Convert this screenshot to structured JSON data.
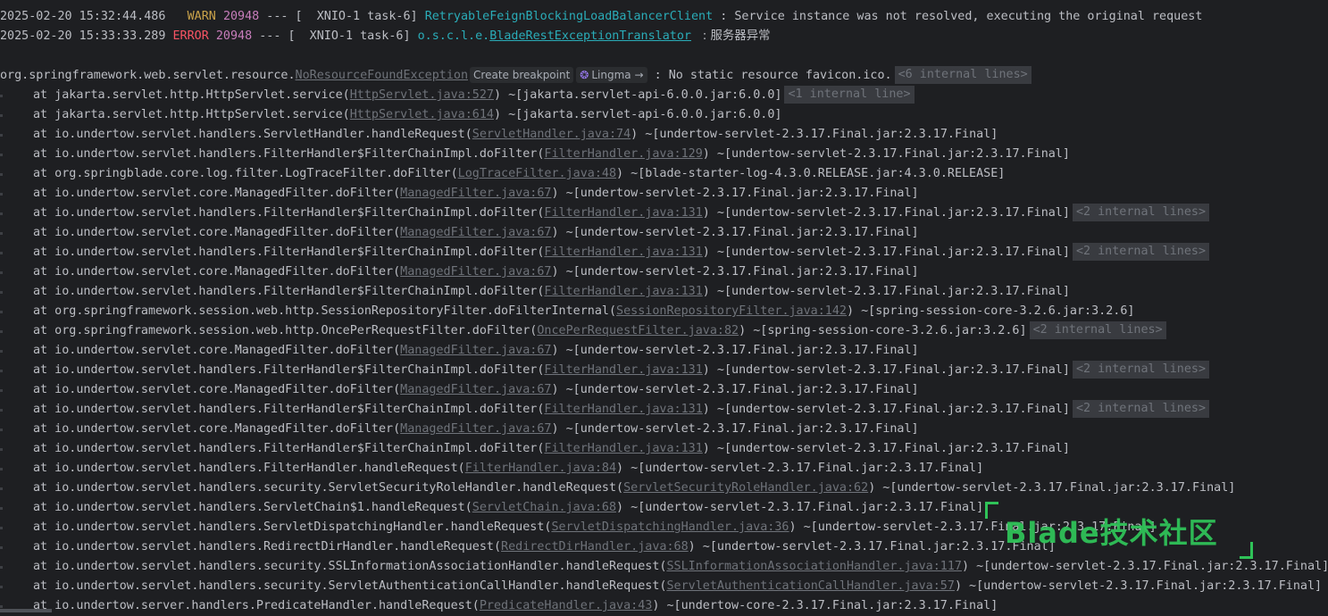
{
  "log_lines": [
    {
      "timestamp": "2025-02-20 15:32:44.486",
      "level": " WARN",
      "pid": "20948",
      "sep": " --- [",
      "thread": "  XNIO-1 task-6]",
      "logger": "RetryableFeignBlockingLoadBalancerClient",
      "message": " : Service instance was not resolved, executing the original request"
    },
    {
      "timestamp": "2025-02-20 15:33:33.289",
      "level": "ERROR",
      "pid": "20948",
      "sep": " --- [",
      "thread": "  XNIO-1 task-6]",
      "logger_prefix": "o.s.c.l.e.",
      "logger": "BladeRestExceptionTranslator",
      "message": "   : 服务器异常"
    }
  ],
  "exception": {
    "package": "org.springframework.web.servlet.resource.",
    "class": "NoResourceFoundException",
    "create_breakpoint": "Create breakpoint",
    "lingma": "Lingma →",
    "message": ": No static resource favicon.ico.",
    "fold": "<6 internal lines>"
  },
  "frames": [
    {
      "method": "at jakarta.servlet.http.HttpServlet.service(",
      "source": "HttpServlet.java:527",
      "jar": ") ~[jakarta.servlet-api-6.0.0.jar:6.0.0]",
      "fold": "<1 internal line>"
    },
    {
      "method": "at jakarta.servlet.http.HttpServlet.service(",
      "source": "HttpServlet.java:614",
      "jar": ") ~[jakarta.servlet-api-6.0.0.jar:6.0.0]",
      "fold": ""
    },
    {
      "method": "at io.undertow.servlet.handlers.ServletHandler.handleRequest(",
      "source": "ServletHandler.java:74",
      "jar": ") ~[undertow-servlet-2.3.17.Final.jar:2.3.17.Final]",
      "fold": ""
    },
    {
      "method": "at io.undertow.servlet.handlers.FilterHandler$FilterChainImpl.doFilter(",
      "source": "FilterHandler.java:129",
      "jar": ") ~[undertow-servlet-2.3.17.Final.jar:2.3.17.Final]",
      "fold": ""
    },
    {
      "method": "at org.springblade.core.log.filter.LogTraceFilter.doFilter(",
      "source": "LogTraceFilter.java:48",
      "jar": ") ~[blade-starter-log-4.3.0.RELEASE.jar:4.3.0.RELEASE]",
      "fold": ""
    },
    {
      "method": "at io.undertow.servlet.core.ManagedFilter.doFilter(",
      "source": "ManagedFilter.java:67",
      "jar": ") ~[undertow-servlet-2.3.17.Final.jar:2.3.17.Final]",
      "fold": ""
    },
    {
      "method": "at io.undertow.servlet.handlers.FilterHandler$FilterChainImpl.doFilter(",
      "source": "FilterHandler.java:131",
      "jar": ") ~[undertow-servlet-2.3.17.Final.jar:2.3.17.Final]",
      "fold": "<2 internal lines>"
    },
    {
      "method": "at io.undertow.servlet.core.ManagedFilter.doFilter(",
      "source": "ManagedFilter.java:67",
      "jar": ") ~[undertow-servlet-2.3.17.Final.jar:2.3.17.Final]",
      "fold": ""
    },
    {
      "method": "at io.undertow.servlet.handlers.FilterHandler$FilterChainImpl.doFilter(",
      "source": "FilterHandler.java:131",
      "jar": ") ~[undertow-servlet-2.3.17.Final.jar:2.3.17.Final]",
      "fold": "<2 internal lines>"
    },
    {
      "method": "at io.undertow.servlet.core.ManagedFilter.doFilter(",
      "source": "ManagedFilter.java:67",
      "jar": ") ~[undertow-servlet-2.3.17.Final.jar:2.3.17.Final]",
      "fold": ""
    },
    {
      "method": "at io.undertow.servlet.handlers.FilterHandler$FilterChainImpl.doFilter(",
      "source": "FilterHandler.java:131",
      "jar": ") ~[undertow-servlet-2.3.17.Final.jar:2.3.17.Final]",
      "fold": ""
    },
    {
      "method": "at org.springframework.session.web.http.SessionRepositoryFilter.doFilterInternal(",
      "source": "SessionRepositoryFilter.java:142",
      "jar": ") ~[spring-session-core-3.2.6.jar:3.2.6]",
      "fold": ""
    },
    {
      "method": "at org.springframework.session.web.http.OncePerRequestFilter.doFilter(",
      "source": "OncePerRequestFilter.java:82",
      "jar": ") ~[spring-session-core-3.2.6.jar:3.2.6]",
      "fold": "<2 internal lines>"
    },
    {
      "method": "at io.undertow.servlet.core.ManagedFilter.doFilter(",
      "source": "ManagedFilter.java:67",
      "jar": ") ~[undertow-servlet-2.3.17.Final.jar:2.3.17.Final]",
      "fold": ""
    },
    {
      "method": "at io.undertow.servlet.handlers.FilterHandler$FilterChainImpl.doFilter(",
      "source": "FilterHandler.java:131",
      "jar": ") ~[undertow-servlet-2.3.17.Final.jar:2.3.17.Final]",
      "fold": "<2 internal lines>"
    },
    {
      "method": "at io.undertow.servlet.core.ManagedFilter.doFilter(",
      "source": "ManagedFilter.java:67",
      "jar": ") ~[undertow-servlet-2.3.17.Final.jar:2.3.17.Final]",
      "fold": ""
    },
    {
      "method": "at io.undertow.servlet.handlers.FilterHandler$FilterChainImpl.doFilter(",
      "source": "FilterHandler.java:131",
      "jar": ") ~[undertow-servlet-2.3.17.Final.jar:2.3.17.Final]",
      "fold": "<2 internal lines>"
    },
    {
      "method": "at io.undertow.servlet.core.ManagedFilter.doFilter(",
      "source": "ManagedFilter.java:67",
      "jar": ") ~[undertow-servlet-2.3.17.Final.jar:2.3.17.Final]",
      "fold": ""
    },
    {
      "method": "at io.undertow.servlet.handlers.FilterHandler$FilterChainImpl.doFilter(",
      "source": "FilterHandler.java:131",
      "jar": ") ~[undertow-servlet-2.3.17.Final.jar:2.3.17.Final]",
      "fold": ""
    },
    {
      "method": "at io.undertow.servlet.handlers.FilterHandler.handleRequest(",
      "source": "FilterHandler.java:84",
      "jar": ") ~[undertow-servlet-2.3.17.Final.jar:2.3.17.Final]",
      "fold": ""
    },
    {
      "method": "at io.undertow.servlet.handlers.security.ServletSecurityRoleHandler.handleRequest(",
      "source": "ServletSecurityRoleHandler.java:62",
      "jar": ") ~[undertow-servlet-2.3.17.Final.jar:2.3.17.Final]",
      "fold": ""
    },
    {
      "method": "at io.undertow.servlet.handlers.ServletChain$1.handleRequest(",
      "source": "ServletChain.java:68",
      "jar": ") ~[undertow-servlet-2.3.17.Final.jar:2.3.17.Final]",
      "fold": ""
    },
    {
      "method": "at io.undertow.servlet.handlers.ServletDispatchingHandler.handleRequest(",
      "source": "ServletDispatchingHandler.java:36",
      "jar": ") ~[undertow-servlet-2.3.17.Final.jar:2.3.17.Final]",
      "fold": ""
    },
    {
      "method": "at io.undertow.servlet.handlers.RedirectDirHandler.handleRequest(",
      "source": "RedirectDirHandler.java:68",
      "jar": ") ~[undertow-servlet-2.3.17.Final.jar:2.3.17.Final]",
      "fold": ""
    },
    {
      "method": "at io.undertow.servlet.handlers.security.SSLInformationAssociationHandler.handleRequest(",
      "source": "SSLInformationAssociationHandler.java:117",
      "jar": ") ~[undertow-servlet-2.3.17.Final.jar:2.3.17.Final]",
      "fold": ""
    },
    {
      "method": "at io.undertow.servlet.handlers.security.ServletAuthenticationCallHandler.handleRequest(",
      "source": "ServletAuthenticationCallHandler.java:57",
      "jar": ") ~[undertow-servlet-2.3.17.Final.jar:2.3.17.Final]",
      "fold": ""
    },
    {
      "method": "at io.undertow.server.handlers.PredicateHandler.handleRequest(",
      "source": "PredicateHandler.java:43",
      "jar": ") ~[undertow-core-2.3.17.Final.jar:2.3.17.Final]",
      "fold": ""
    }
  ],
  "watermark": {
    "text": "Blade技术社区"
  }
}
